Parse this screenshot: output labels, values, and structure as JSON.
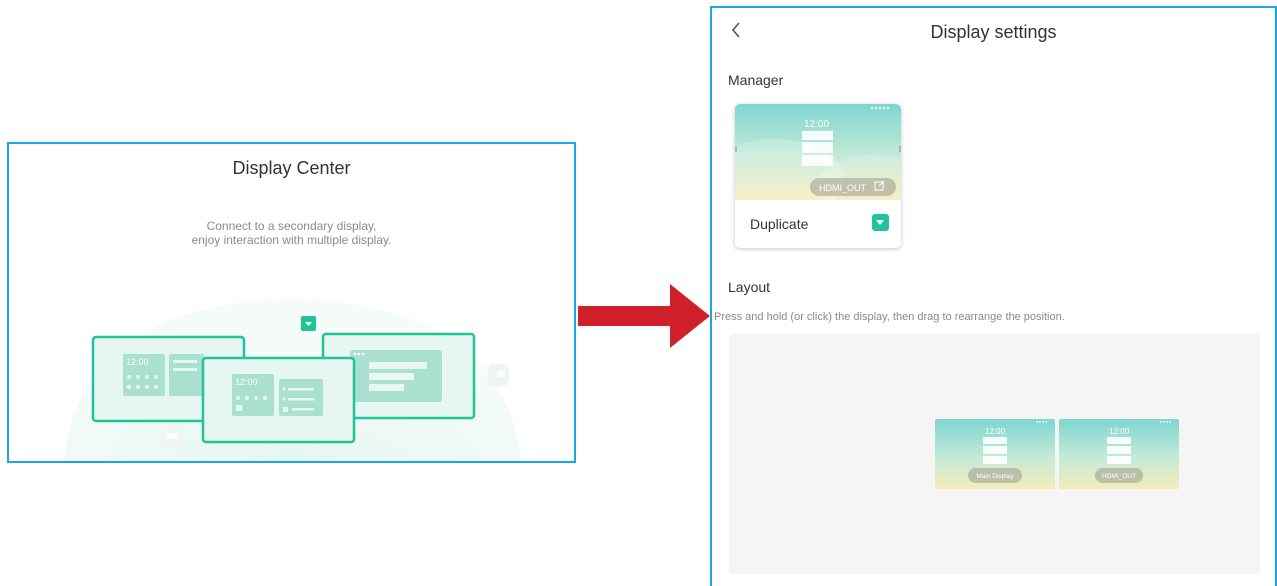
{
  "display_center": {
    "title": "Display Center",
    "subtitle_line1": "Connect to a secondary display,",
    "subtitle_line2": "enjoy interaction with multiple display.",
    "illustration_time_left": "12:00",
    "illustration_time_center": "12:00"
  },
  "display_settings": {
    "back_icon": "chevron-left-icon",
    "title": "Display settings",
    "manager": {
      "label": "Manager",
      "thumb_time": "12:00",
      "output_label": "HDMI_OUT",
      "mode": "Duplicate"
    },
    "layout": {
      "label": "Layout",
      "hint": "Press and hold (or click) the display, then drag to rearrange the position.",
      "displays": [
        {
          "time": "12:00",
          "name": "Main Display"
        },
        {
          "time": "12:00",
          "name": "HDMI_OUT"
        }
      ]
    }
  },
  "colors": {
    "panel_border": "#1aa7e8",
    "accent": "#20c39a",
    "arrow": "#d0202b"
  }
}
